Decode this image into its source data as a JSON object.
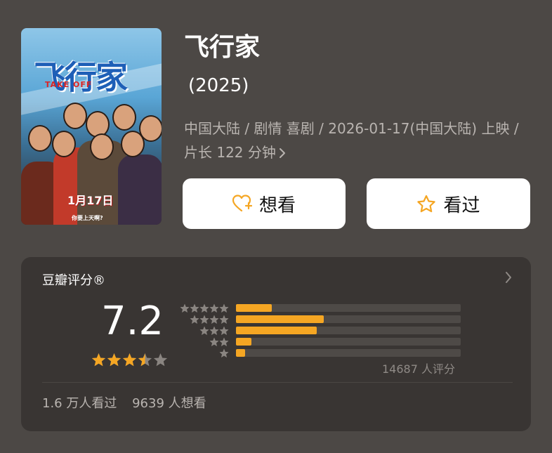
{
  "movie": {
    "title": "飞行家",
    "year": "(2025)",
    "meta": "中国大陆 / 剧情 喜剧 / 2026-01-17(中国大陆) 上映 / 片长 122 分钟",
    "meta_chevron_icon": "chevron-right-icon"
  },
  "poster": {
    "title_text": "飞行家",
    "subtitle_text": "TAKE OFF",
    "date_text": "1月17日",
    "tagline_text": "你要上天啊?"
  },
  "actions": {
    "want_label": "想看",
    "want_icon": "heart-plus-icon",
    "seen_label": "看过",
    "seen_icon": "star-outline-icon"
  },
  "rating": {
    "section_title": "豆瓣评分®",
    "arrow_icon": "chevron-right-icon",
    "score": "7.2",
    "stars_value": 3.5,
    "stars_max": 5,
    "distribution": [
      {
        "stars": 5,
        "fraction": 0.16
      },
      {
        "stars": 4,
        "fraction": 0.39
      },
      {
        "stars": 3,
        "fraction": 0.36
      },
      {
        "stars": 2,
        "fraction": 0.07
      },
      {
        "stars": 1,
        "fraction": 0.04
      }
    ],
    "count_text": "14687 人评分",
    "seen_count_text": "1.6 万人看过",
    "want_count_text": "9639 人想看"
  },
  "colors": {
    "background": "#4c4845",
    "card": "#393533",
    "accent": "#f5a623",
    "track": "#4e4a47",
    "muted_text": "#b9b4b0"
  }
}
